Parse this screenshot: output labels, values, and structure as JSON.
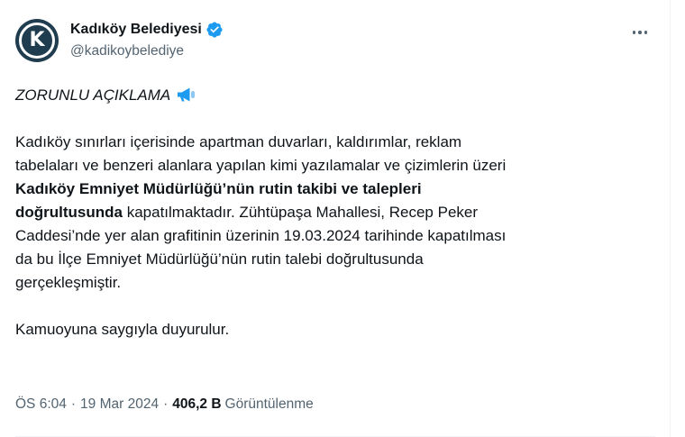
{
  "author": {
    "display_name": "Kadıköy Belediyesi",
    "handle": "@kadikoybelediye",
    "avatar_letter": "K",
    "avatar_color": "#1f3d4f",
    "verified_color": "#1d9bf0"
  },
  "tweet": {
    "heading": "ZORUNLU AÇIKLAMA",
    "heading_icon": "megaphone-icon",
    "p1_line1": "Kadıköy sınırları içerisinde apartman duvarları, kaldırımlar, reklam",
    "p1_line2": "tabelaları ve benzeri alanlara yapılan kimi yazılamalar ve çizimlerin üzeri",
    "p1_line3_bold": "Kadıköy Emniyet Müdürlüğü’nün rutin takibi ve talepleri",
    "p1_line4_bold": "doğrultusunda",
    "p1_line4_rest": " kapatılmaktadır. Zühtüpaşa Mahallesi, Recep Peker",
    "p1_line5": "Caddesi’nde yer alan grafitinin üzerinin 19.03.2024 tarihinde kapatılması",
    "p1_line6": "da bu İlçe Emniyet Müdürlüğü’nün rutin talebi doğrultusunda",
    "p1_line7": "gerçekleşmiştir.",
    "p2": "Kamuoyuna saygıyla duyurulur."
  },
  "meta": {
    "time": "ÖS 6:04",
    "date": "19 Mar 2024",
    "separator": "·",
    "views_count": "406,2 B",
    "views_label": "Görüntülenme"
  },
  "colors": {
    "text_primary": "#0f1419",
    "text_secondary": "#536471",
    "divider": "#eff3f4",
    "megaphone": "#1d9bf0"
  }
}
